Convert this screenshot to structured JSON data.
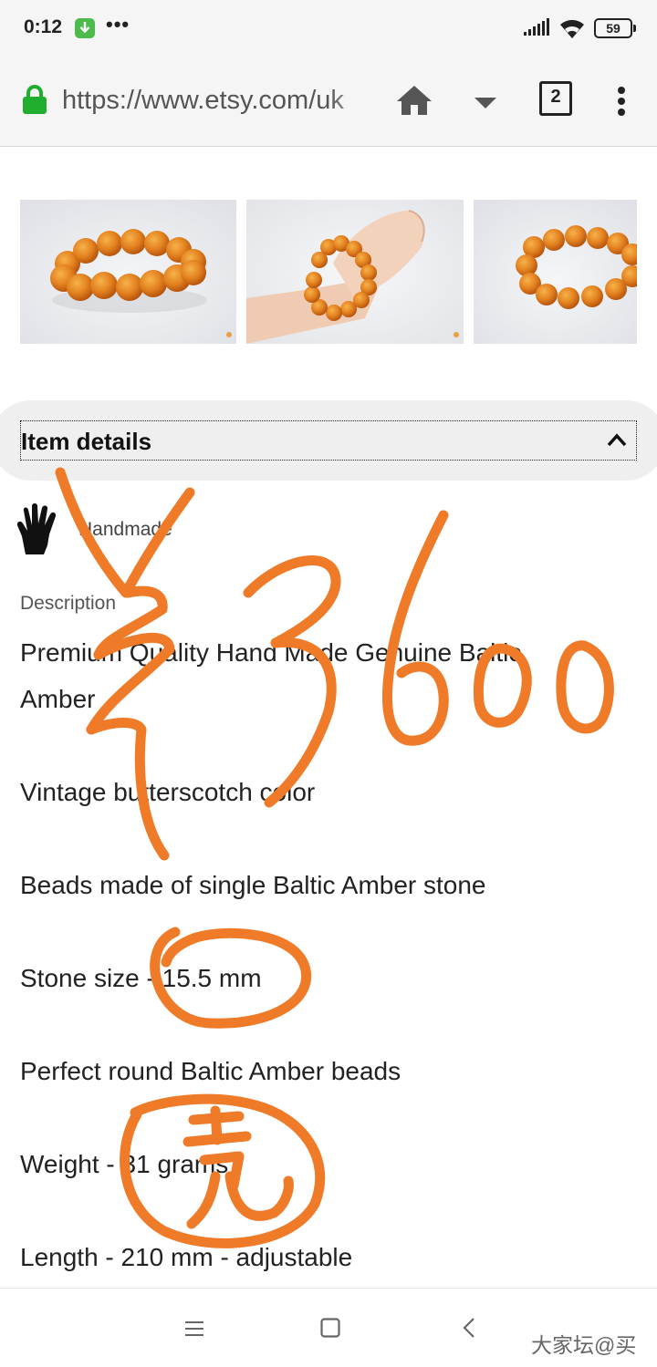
{
  "status_bar": {
    "time": "0:12",
    "dots": "•••",
    "battery": "59"
  },
  "browser": {
    "url": "https://www.etsy.com/uk",
    "tab_count": "2"
  },
  "item_details": {
    "title": "Item details",
    "handmade": "Handmade",
    "description_label": "Description",
    "description_lines": [
      "Premium Quality Hand Made Genuine Baltic",
      "Amber",
      "Vintage butterscotch color",
      "Beads made of single Baltic Amber stone",
      "Stone size - 15.5 mm",
      "Perfect round Baltic Amber beads",
      "Weight - 31 grams",
      "Length - 210 mm - adjustable"
    ]
  },
  "watermark": "大家坛@买",
  "colors": {
    "amber": "#e88a2a",
    "ink": "#ef7a28",
    "lock_green": "#1fae2d"
  }
}
